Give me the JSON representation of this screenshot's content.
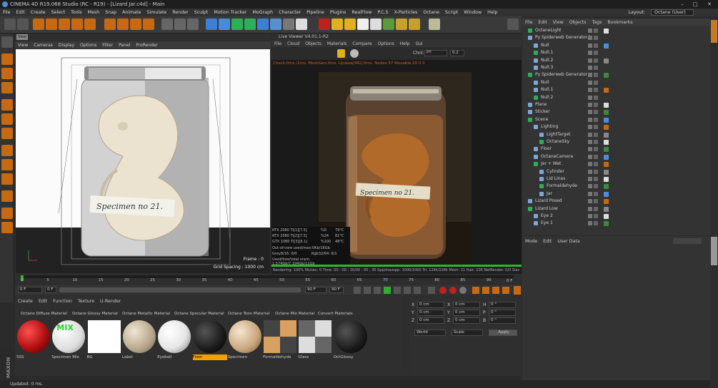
{
  "window": {
    "title": "CINEMA 4D R19.068 Studio (RC - R19) - [Lizard Jar.c4d] - Main"
  },
  "menubar": {
    "items": [
      "File",
      "Edit",
      "Create",
      "Select",
      "Tools",
      "Mesh",
      "Snap",
      "Animate",
      "Simulate",
      "Render",
      "Sculpt",
      "Motion Tracker",
      "MoGraph",
      "Character",
      "Pipeline",
      "Plugins",
      "RealFlow",
      "P.C.S",
      "X-Particles",
      "Octane",
      "Script",
      "Window",
      "Help"
    ],
    "layout_label": "Layout:",
    "layout_value": "Octane (User)"
  },
  "viewport": {
    "tab": "View",
    "menu": [
      "View",
      "Cameras",
      "Display",
      "Options",
      "Filter",
      "Panel",
      "ProRender"
    ],
    "frame": "Frame : 0",
    "grid": "Grid Spacing : 1000 cm",
    "label_text": "Specimen no 21."
  },
  "liveviewer": {
    "title": "Live Viewer V4.01.1-R2",
    "menu": [
      "File",
      "Cloud",
      "Objects",
      "Materials",
      "Compare",
      "Options",
      "Help",
      "Gui"
    ],
    "channel_label": "Chnl:",
    "channel_value": "PT",
    "zoom": "0.2",
    "status": "Check:0ms./1ms. MeshGen:0ms. Update[MG]:0ms. Nodes:57 Movable:20 0 0",
    "stats": [
      {
        "gpu": "RTX 2080 Ti[1][7.5]",
        "pct": "%0",
        "temp": "79°C"
      },
      {
        "gpu": "RTX 2080 Ti[2][7.5]",
        "pct": "%24",
        "temp": "81°C"
      },
      {
        "gpu": "GTX 1080 Ti[3][6.1]",
        "pct": "%100",
        "temp": "48°C"
      }
    ],
    "outofcore": "Out-of-core used/max:0Kb/16Gb",
    "grey": "Grey8/16: 0/0",
    "rgb": "Rgb32/64: 6/1",
    "vram": "Used/free/total vram: 1.574Gb/7.194Gb/11Gb",
    "bottom": "Rendering: 100%  Ms/sec: 0  Time: 00 : 00 : 30/00 : 00 : 30  Spp/maxspp: 1000/1000  Tri: 124k/104k  Mesh: 21  Hair: 106  NetRender: 0/0  Slav",
    "label_text": "Specimen no 21."
  },
  "objects": {
    "menu": [
      "File",
      "Edit",
      "View",
      "Objects",
      "Tags",
      "Bookmarks"
    ],
    "rows": [
      {
        "name": "OctaneLight",
        "indent": 0
      },
      {
        "name": "Py Spiderweb Generator.1",
        "indent": 0
      },
      {
        "name": "Null",
        "indent": 1
      },
      {
        "name": "Null.1",
        "indent": 1
      },
      {
        "name": "Null.2",
        "indent": 1
      },
      {
        "name": "Null.3",
        "indent": 1
      },
      {
        "name": "Py Spiderweb Generator",
        "indent": 0
      },
      {
        "name": "Null",
        "indent": 1
      },
      {
        "name": "Null.1",
        "indent": 1
      },
      {
        "name": "Null.2",
        "indent": 1
      },
      {
        "name": "Plane",
        "indent": 0
      },
      {
        "name": "Sticker",
        "indent": 0
      },
      {
        "name": "Scene",
        "indent": 0
      },
      {
        "name": "Lighting",
        "indent": 1
      },
      {
        "name": "LightTarget",
        "indent": 2
      },
      {
        "name": "OctaneSky",
        "indent": 2
      },
      {
        "name": "Floor",
        "indent": 1
      },
      {
        "name": "OctaneCamera",
        "indent": 1
      },
      {
        "name": "Jar + Wet",
        "indent": 1
      },
      {
        "name": "Cylinder",
        "indent": 2
      },
      {
        "name": "Lid Lines",
        "indent": 2
      },
      {
        "name": "Formaldehyde",
        "indent": 2
      },
      {
        "name": "Jar",
        "indent": 2
      },
      {
        "name": "Lizard Posed",
        "indent": 0
      },
      {
        "name": "Lizard Low",
        "indent": 0
      },
      {
        "name": "Eye 2",
        "indent": 1
      },
      {
        "name": "Eye 1",
        "indent": 1
      }
    ]
  },
  "attributes": {
    "menu": [
      "Mode",
      "Edit",
      "User Data"
    ]
  },
  "timeline": {
    "ticks": [
      "0",
      "5",
      "10",
      "15",
      "20",
      "25",
      "30",
      "35",
      "40",
      "45",
      "50",
      "55",
      "60",
      "65",
      "70",
      "75",
      "80",
      "85",
      "90"
    ],
    "end": "0 F"
  },
  "transport": {
    "start": "0 F",
    "current": "0 F",
    "end": "90 F",
    "end2": "90 F"
  },
  "materials": {
    "menu": [
      "Create",
      "Edit",
      "Function",
      "Texture",
      "U-Render"
    ],
    "presets": [
      "Octane Diffuse Material",
      "Octane Glossy Material",
      "Octane Metallic Material",
      "Octane Specular Material",
      "Octane Toon Material",
      "Octane Mix Material",
      "Convert Materials"
    ],
    "items": [
      {
        "name": "SSS"
      },
      {
        "name": "Specimen Mix",
        "badge": "MIX"
      },
      {
        "name": "BG"
      },
      {
        "name": "Label"
      },
      {
        "name": "Eyeball"
      },
      {
        "name": "Floor"
      },
      {
        "name": "Specimen"
      },
      {
        "name": "Formaldehyde"
      },
      {
        "name": "Glass"
      },
      {
        "name": "OctGlossy"
      }
    ]
  },
  "coords": {
    "rows": [
      {
        "a": "X",
        "av": "0 cm",
        "b": "X",
        "bv": "0 cm",
        "c": "H",
        "cv": "0 °"
      },
      {
        "a": "Y",
        "av": "0 cm",
        "b": "Y",
        "bv": "0 cm",
        "c": "P",
        "cv": "0 °"
      },
      {
        "a": "Z",
        "av": "0 cm",
        "b": "Z",
        "bv": "0 cm",
        "c": "B",
        "cv": "0 °"
      }
    ],
    "world": "World",
    "scale": "Scale",
    "apply": "Apply"
  },
  "statusbar": {
    "text": "Updated: 0 ms."
  },
  "colors": {
    "accent": "#d9761a",
    "active_tool": "#c56a12",
    "selected_material": "#f0a000"
  }
}
